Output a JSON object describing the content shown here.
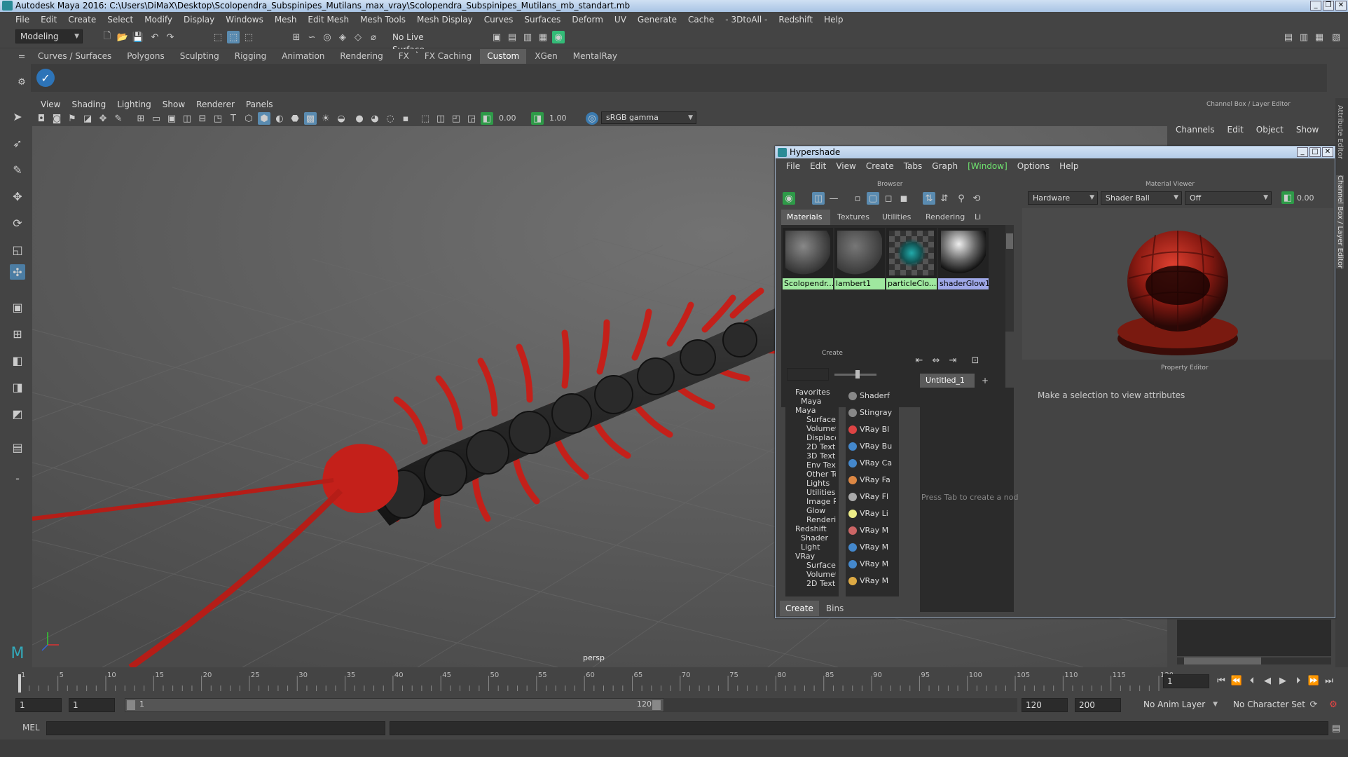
{
  "window": {
    "title": "Autodesk Maya 2016: C:\\Users\\DiMaX\\Desktop\\Scolopendra_Subspinipes_Mutilans_max_vray\\Scolopendra_Subspinipes_Mutilans_mb_standart.mb"
  },
  "menubar": [
    "File",
    "Edit",
    "Create",
    "Select",
    "Modify",
    "Display",
    "Windows",
    "Mesh",
    "Edit Mesh",
    "Mesh Tools",
    "Mesh Display",
    "Curves",
    "Surfaces",
    "Deform",
    "UV",
    "Generate",
    "Cache",
    "- 3DtoAll -",
    "Redshift",
    "Help"
  ],
  "status": {
    "workspace": "Modeling",
    "live_surface": "No Live Surface"
  },
  "shelf_tabs": [
    "Curves / Surfaces",
    "Polygons",
    "Sculpting",
    "Rigging",
    "Animation",
    "Rendering",
    "FX",
    "FX Caching",
    "Custom",
    "XGen",
    "MentalRay"
  ],
  "shelf_active": "Custom",
  "viewport": {
    "menu": [
      "View",
      "Shading",
      "Lighting",
      "Show",
      "Renderer",
      "Panels"
    ],
    "exposure": "0.00",
    "gamma": "1.00",
    "colorspace": "sRGB gamma",
    "camera": "persp"
  },
  "channelbox": {
    "title": "Channel Box / Layer Editor",
    "menu": [
      "Channels",
      "Edit",
      "Object",
      "Show"
    ]
  },
  "side_tabs": [
    "Attribute Editor",
    "Channel Box / Layer Editor"
  ],
  "hypershade": {
    "title": "Hypershade",
    "menu": [
      "File",
      "Edit",
      "View",
      "Create",
      "Tabs",
      "Graph",
      "[Window]",
      "Options",
      "Help"
    ],
    "browser_title": "Browser",
    "browser_tabs": [
      "Materials",
      "Textures",
      "Utilities",
      "Rendering",
      "Li"
    ],
    "materials": [
      "Scolopendr...",
      "lambert1",
      "particleClo...",
      "shaderGlow1"
    ],
    "create_title": "Create",
    "create_tree": [
      "Favorites",
      "Maya",
      "Maya",
      "Surface",
      "Volumet",
      "Displace",
      "2D Textu",
      "3D Textu",
      "Env Text",
      "Other Te",
      "Lights",
      "Utilities",
      "Image P",
      "Glow",
      "Renderi",
      "Redshift",
      "Shader",
      "Light",
      "VRay",
      "Surface",
      "Volumet",
      "2D Textu"
    ],
    "create_list": [
      "Shaderf",
      "Stingray",
      "VRay Bl",
      "VRay Bu",
      "VRay Ca",
      "VRay Fa",
      "VRay Fl",
      "VRay Li",
      "VRay M",
      "VRay M",
      "VRay M",
      "VRay M"
    ],
    "bottom_tabs": [
      "Create",
      "Bins"
    ],
    "graph_tab": "Untitled_1",
    "graph_hint": "Press Tab to create a nod",
    "viewer_title": "Material Viewer",
    "viewer_renderer": "Hardware",
    "viewer_shape": "Shader Ball",
    "viewer_mode": "Off",
    "viewer_value": "0.00",
    "property_title": "Property Editor",
    "property_hint": "Make a selection to view attributes"
  },
  "timeline": {
    "ticks": [
      "1",
      "5",
      "10",
      "15",
      "20",
      "25",
      "30",
      "35",
      "40",
      "45",
      "50",
      "55",
      "60",
      "65",
      "70",
      "75",
      "80",
      "85",
      "90",
      "95",
      "100",
      "105",
      "110",
      "115",
      "120"
    ],
    "current": "1"
  },
  "range": {
    "start": "1",
    "start2": "1",
    "slider_start": "1",
    "slider_end": "120",
    "end": "120",
    "end2": "200",
    "anim_layer": "No Anim Layer",
    "char_set": "No Character Set"
  },
  "mel": {
    "label": "MEL"
  },
  "colors": {
    "accent_green": "#6fe36f",
    "centipede_red": "#c4201a",
    "selection_blue": "#5a8bb0"
  }
}
